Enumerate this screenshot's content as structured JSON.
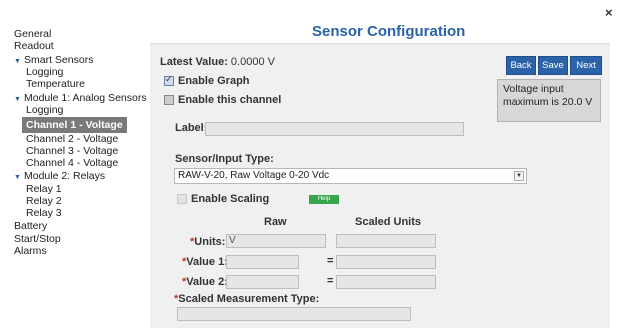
{
  "close_label": "×",
  "title": "Sensor Configuration",
  "sidebar": {
    "items": [
      {
        "label": "General",
        "indent": 0,
        "toggle": false
      },
      {
        "label": "Readout",
        "indent": 0,
        "toggle": false
      },
      {
        "label": "Smart Sensors",
        "indent": 0,
        "toggle": true
      },
      {
        "label": "Logging",
        "indent": 1,
        "toggle": false
      },
      {
        "label": "Temperature",
        "indent": 1,
        "toggle": false
      },
      {
        "label": "Module 1: Analog Sensors",
        "indent": 0,
        "toggle": true
      },
      {
        "label": "Logging",
        "indent": 1,
        "toggle": false
      },
      {
        "label": "Channel 1 - Voltage",
        "indent": 1,
        "toggle": false,
        "active": true
      },
      {
        "label": "Channel 2 - Voltage",
        "indent": 1,
        "toggle": false
      },
      {
        "label": "Channel 3 - Voltage",
        "indent": 1,
        "toggle": false
      },
      {
        "label": "Channel 4 - Voltage",
        "indent": 1,
        "toggle": false
      },
      {
        "label": "Module 2: Relays",
        "indent": 0,
        "toggle": true
      },
      {
        "label": "Relay 1",
        "indent": 1,
        "toggle": false
      },
      {
        "label": "Relay 2",
        "indent": 1,
        "toggle": false
      },
      {
        "label": "Relay 3",
        "indent": 1,
        "toggle": false
      },
      {
        "label": "Battery",
        "indent": 0,
        "toggle": false
      },
      {
        "label": "Start/Stop",
        "indent": 0,
        "toggle": false
      },
      {
        "label": "Alarms",
        "indent": 0,
        "toggle": false
      }
    ]
  },
  "latest": {
    "label": "Latest Value:",
    "value": "0.0000 V"
  },
  "buttons": {
    "back": "Back",
    "save": "Save",
    "next": "Next"
  },
  "info": "Voltage input maximum is 20.0 V",
  "enable_graph": {
    "label": "Enable Graph",
    "checked": true
  },
  "enable_channel": {
    "label": "Enable this channel",
    "checked": false
  },
  "label_field": {
    "label": "Label:",
    "value": ""
  },
  "sensor_type": {
    "label": "Sensor/Input Type:",
    "value": "RAW-V-20, Raw Voltage 0-20 Vdc"
  },
  "scaling": {
    "label": "Enable Scaling",
    "help": "Help"
  },
  "columns": {
    "raw": "Raw",
    "scaled": "Scaled Units"
  },
  "units": {
    "label": "Units:",
    "raw_value": "V",
    "scaled_value": ""
  },
  "value1": {
    "label": "Value 1:",
    "eq": "="
  },
  "value2": {
    "label": "Value 2:",
    "eq": "="
  },
  "measurement": {
    "label": "Scaled Measurement Type:"
  },
  "required_mark": "*"
}
